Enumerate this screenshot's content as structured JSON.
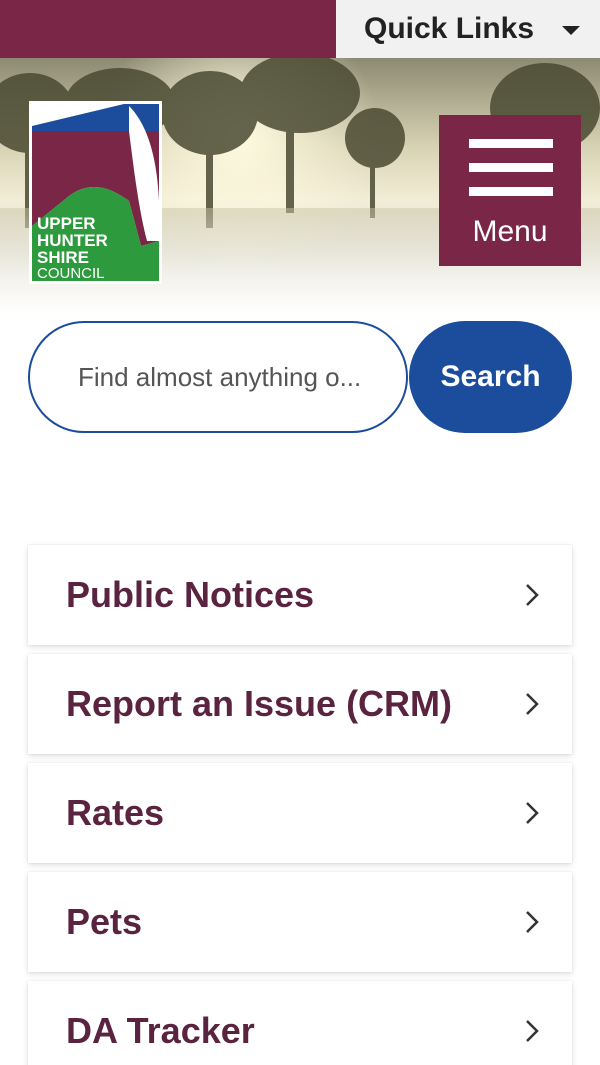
{
  "header": {
    "quick_links_label": "Quick Links",
    "quick_links_icon": "caret-down-icon",
    "brand_color": "#7a2646",
    "menu_label": "Menu",
    "menu_icon": "hamburger-icon"
  },
  "logo": {
    "lines": [
      "UPPER",
      "HUNTER",
      "SHIRE",
      "COUNCIL"
    ],
    "colors": {
      "blue": "#1c4c9c",
      "maroon": "#7a2646",
      "green": "#2e9a3e"
    }
  },
  "search": {
    "placeholder": "Find almost anything o...",
    "button_label": "Search",
    "accent": "#1c4c9c"
  },
  "quick_items": [
    {
      "label": "Public Notices",
      "icon": "chevron-right-icon"
    },
    {
      "label": "Report an Issue (CRM)",
      "icon": "chevron-right-icon"
    },
    {
      "label": "Rates",
      "icon": "chevron-right-icon"
    },
    {
      "label": "Pets",
      "icon": "chevron-right-icon"
    },
    {
      "label": "DA Tracker",
      "icon": "chevron-right-icon"
    }
  ]
}
